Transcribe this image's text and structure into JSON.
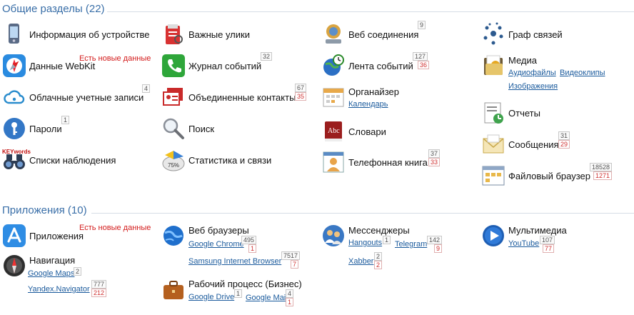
{
  "sections": {
    "general": {
      "title": "Общие разделы (22)"
    },
    "apps": {
      "title": "Приложения (10)"
    }
  },
  "new_data_label": "Есть новые данные",
  "items": {
    "device_info": {
      "label": "Информация об устройстве"
    },
    "webkit": {
      "label": "Данные WebKit"
    },
    "cloud_accounts": {
      "label": "Облачные учетные записи",
      "count": "4"
    },
    "passwords": {
      "label": "Пароли",
      "count": "1"
    },
    "watchlists": {
      "label": "Списки наблюдения",
      "keywords": "KEYwords"
    },
    "evidence": {
      "label": "Важные улики"
    },
    "event_log": {
      "label": "Журнал событий",
      "count": "32"
    },
    "merged_contacts": {
      "label": "Объединенные контакты",
      "count": "67",
      "new": "35"
    },
    "search": {
      "label": "Поиск"
    },
    "stats": {
      "label": "Статистика и связи",
      "percent": "75%"
    },
    "web_connections": {
      "label": "Веб соединения",
      "count": "9"
    },
    "event_feed": {
      "label": "Лента событий",
      "count": "127",
      "new": "36"
    },
    "organizer": {
      "label": "Органайзер",
      "link": "Календарь"
    },
    "dictionaries": {
      "label": "Словари"
    },
    "phonebook": {
      "label": "Телефонная книга",
      "count": "37",
      "new": "33"
    },
    "graph": {
      "label": "Граф связей"
    },
    "media": {
      "label": "Медиа",
      "link1": "Аудиофайлы",
      "link2": "Видеоклипы",
      "link3": "Изображения"
    },
    "reports": {
      "label": "Отчеты"
    },
    "messages": {
      "label": "Сообщения",
      "count": "31",
      "new": "29"
    },
    "file_browser": {
      "label": "Файловый браузер",
      "count": "18528",
      "new": "1271"
    },
    "applications": {
      "label": "Приложения"
    },
    "navigation": {
      "label": "Навигация",
      "link1": "Google Maps",
      "count1": "2",
      "link2": "Yandex.Navigator",
      "count2": "777",
      "new2": "212"
    },
    "web_browsers": {
      "label": "Веб браузеры",
      "link1": "Google Chrome",
      "count1": "495",
      "new1": "1",
      "link2": "Samsung Internet Browser",
      "count2": "7517",
      "new2": "7"
    },
    "workflow": {
      "label": "Рабочий процесс (Бизнес)",
      "link1": "Google Drive",
      "count1": "1",
      "link2": "Google Mail",
      "count2": "4",
      "new2": "1"
    },
    "messengers": {
      "label": "Мессенджеры",
      "link1": "Hangouts",
      "count1": "1",
      "link2": "Telegram",
      "count2": "142",
      "new2": "9",
      "link3": "Xabber",
      "count3": "2",
      "new3": "2"
    },
    "multimedia": {
      "label": "Мультимедиа",
      "link1": "YouTube",
      "count1": "107",
      "new1": "77"
    }
  }
}
